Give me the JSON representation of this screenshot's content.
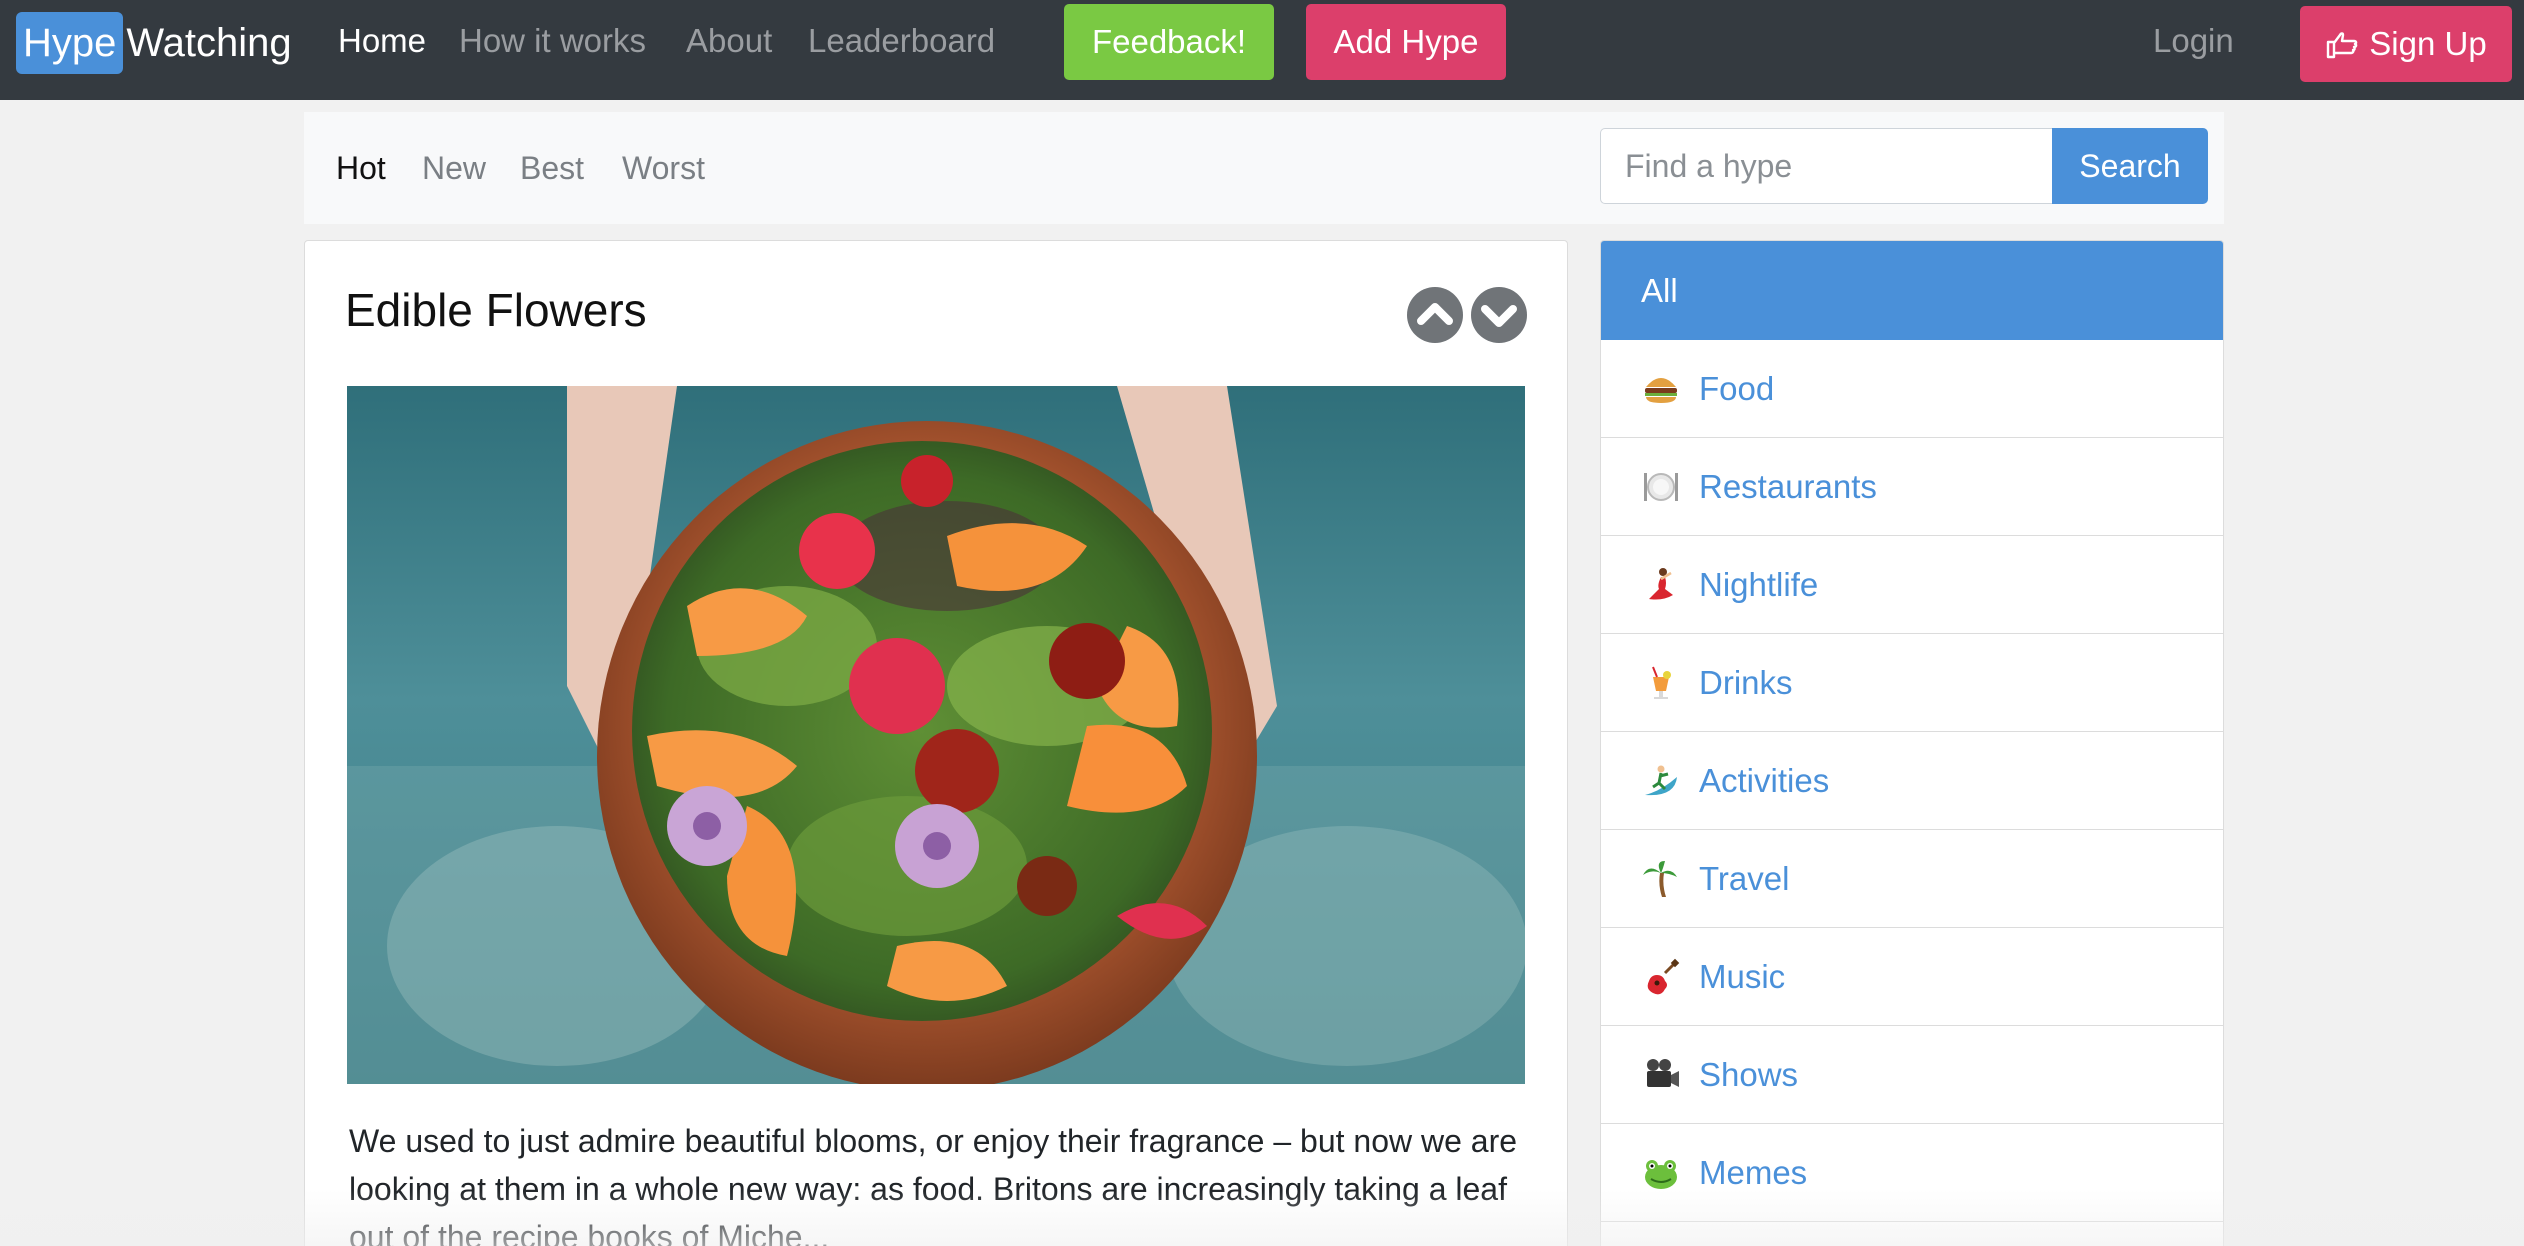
{
  "brand": {
    "part1": "Hype",
    "part2": "Watching"
  },
  "nav": {
    "home": "Home",
    "how": "How it works",
    "about": "About",
    "leaderboard": "Leaderboard",
    "feedback": "Feedback!",
    "add_hype": "Add Hype",
    "login": "Login",
    "signup": "Sign Up"
  },
  "filters": [
    "Hot",
    "New",
    "Best",
    "Worst"
  ],
  "search": {
    "placeholder": "Find a hype",
    "button": "Search"
  },
  "post": {
    "title": "Edible Flowers",
    "excerpt": "We used to just admire beautiful blooms, or enjoy their fragrance – but now we are looking at them in a whole new way: as food. Britons are increasingly taking a leaf out of the recipe books of Miche..."
  },
  "categories": [
    {
      "label": "All",
      "icon": "none"
    },
    {
      "label": "Food",
      "icon": "hamburger-icon"
    },
    {
      "label": "Restaurants",
      "icon": "plate-icon"
    },
    {
      "label": "Nightlife",
      "icon": "dancer-icon"
    },
    {
      "label": "Drinks",
      "icon": "tropical-drink-icon"
    },
    {
      "label": "Activities",
      "icon": "surfer-icon"
    },
    {
      "label": "Travel",
      "icon": "palm-tree-icon"
    },
    {
      "label": "Music",
      "icon": "guitar-icon"
    },
    {
      "label": "Shows",
      "icon": "movie-camera-icon"
    },
    {
      "label": "Memes",
      "icon": "frog-icon"
    }
  ],
  "colors": {
    "navbar": "#343a40",
    "accent": "#4a90d9",
    "feedback": "#7ac943",
    "pink": "#dc3f6b"
  }
}
